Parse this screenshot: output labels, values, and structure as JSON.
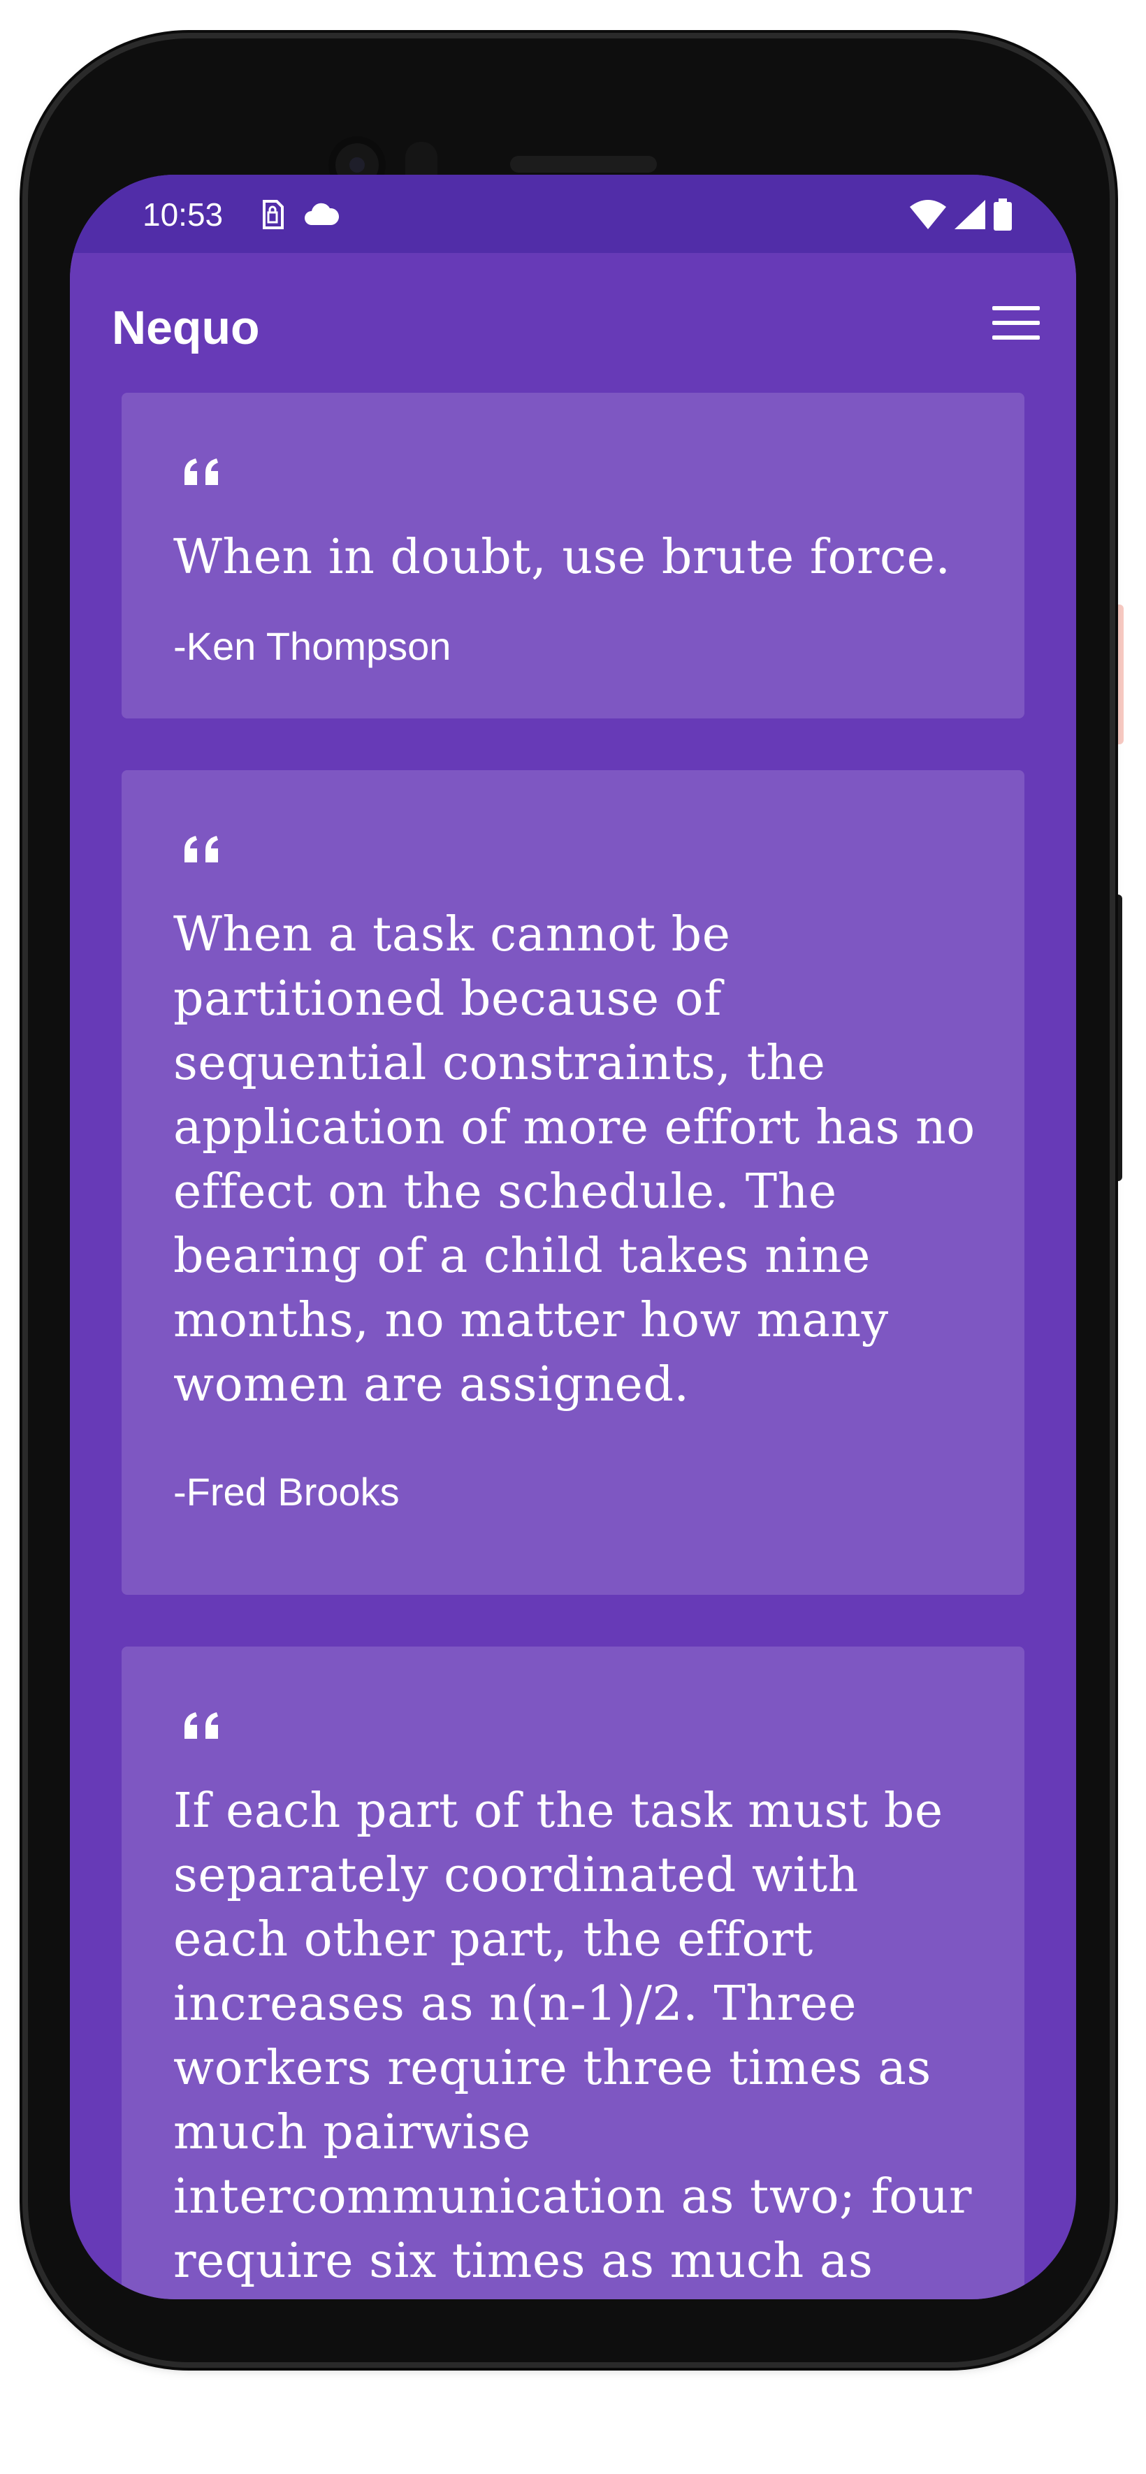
{
  "status_bar": {
    "time": "10:53",
    "icons_left": [
      "sim-lock-icon",
      "cloud-icon"
    ],
    "icons_right": [
      "wifi-icon",
      "signal-icon",
      "battery-icon"
    ]
  },
  "app_bar": {
    "title": "Nequo",
    "menu_icon": "hamburger-menu-icon"
  },
  "quotes": [
    {
      "text": "When in doubt, use brute force.",
      "author": "-Ken Thompson"
    },
    {
      "text": "When a task cannot be partitioned because of sequential constraints, the application of more effort has no effect on the schedule. The bearing of a child takes nine months, no matter how many women are assigned.",
      "author": "-Fred Brooks"
    },
    {
      "text": "If each part of the task must be separately coordinated with each other part, the effort increases as n(n-1)/2. Three workers require three times as much pairwise intercommunication as two; four require six times as much as two.",
      "author": ""
    }
  ],
  "colors": {
    "primary": "#673ab7",
    "primary_dark": "#512da8",
    "card": "#7e57c2",
    "text": "#ffffff"
  }
}
